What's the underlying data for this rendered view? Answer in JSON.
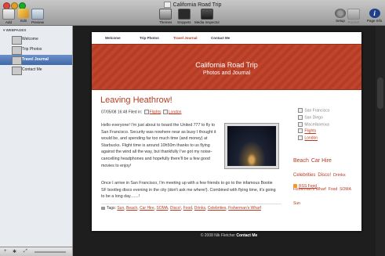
{
  "window": {
    "title": "California Road Trip"
  },
  "toolbar": {
    "add": "Add",
    "edit": "Edit",
    "preview": "Preview",
    "themes": "Themes",
    "snippets": "Snippets",
    "media_inspector": "Media Inspector",
    "setup": "Setup",
    "publish": "Publish",
    "page_info": "Page Info"
  },
  "sidebar": {
    "header": "WEBPAGES",
    "items": [
      {
        "label": "Welcome"
      },
      {
        "label": "Trip Photos"
      },
      {
        "label": "Travel Journal"
      },
      {
        "label": "Contact Me"
      }
    ],
    "bottom": {
      "add": "+",
      "menu": "✱",
      "scale": "⤢",
      "zoom": "⇔"
    }
  },
  "site": {
    "nav": [
      "Welcome",
      "Trip Photos",
      "Travel Journal",
      "Contact Me"
    ],
    "title": "California Road Trip",
    "subtitle": "Photos and Journal"
  },
  "post": {
    "title": "Leaving Heathrow!",
    "meta_prefix": "07/05/08 16:48 Filed in:",
    "categories": [
      "Flights",
      "London"
    ],
    "paragraph1": "Hello everyone! I'm just about to board the United 777 to fly to San Francisco. Security was nowhere near as busy I thought it would be, and spending far too much time (and money) at Starbucks. Flight time is around 10h50m thanks to us flying against the wind all the way, but thankfully I've got my noise-cancelling headphones and hopefully there'll be a few good movies to enjoy!",
    "paragraph2": "Once I arrive in San Francisco, I'm meeting up with a few friends to go to the infamous Bootie SF bootleg disco evening in the city (don't ask me where!). Combined with flying time, it's going to be a long day.......!",
    "tags_prefix": "Tags:",
    "tags": [
      "Sun",
      "Beach",
      "Car Hire",
      "SOMA",
      "Disco!",
      "Food",
      "Drinks",
      "Celebrities",
      "Fisherman's Wharf"
    ]
  },
  "sidebar_widgets": {
    "categories": [
      "San Francisco",
      "San Diego",
      "Miscellaneous",
      "Flights",
      "London"
    ],
    "tag_cloud": [
      {
        "text": "Beach",
        "size": 7
      },
      {
        "text": "Car Hire",
        "size": 7
      },
      {
        "text": "Celebrities",
        "size": 6
      },
      {
        "text": "Disco!",
        "size": 6
      },
      {
        "text": "Drinks",
        "size": 5.5
      },
      {
        "text": "Fisherman's Wharf",
        "size": 5
      },
      {
        "text": "Food",
        "size": 5
      },
      {
        "text": "SOMA",
        "size": 5
      },
      {
        "text": "Sun",
        "size": 5
      }
    ],
    "rss": "RSS Feed"
  },
  "footer": {
    "copyright": "© 2008 Nik Fletcher",
    "contact": "Contact Me"
  },
  "colors": {
    "accent": "#b83a1f",
    "banner": "#c0452c",
    "selection": "#3f68ab"
  }
}
